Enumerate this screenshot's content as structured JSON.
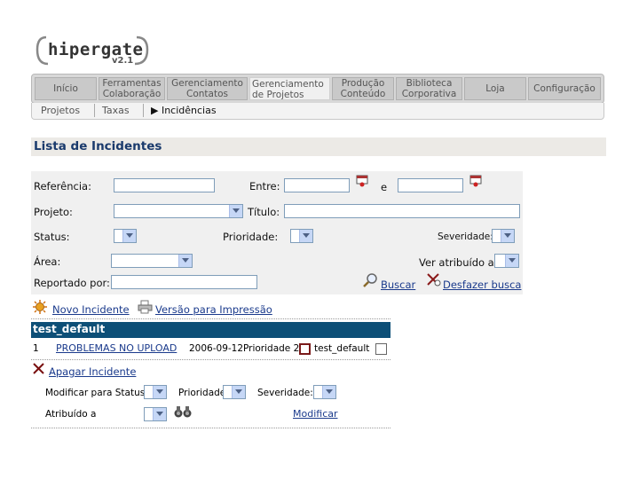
{
  "logo": {
    "name": "hipergate",
    "version": "v2.1"
  },
  "tabs": [
    {
      "l1": "Início",
      "l2": ""
    },
    {
      "l1": "Ferramentas",
      "l2": "Colaboração"
    },
    {
      "l1": "Gerenciamento",
      "l2": "Contatos"
    },
    {
      "l1": "Gerenciamento",
      "l2": "de Projetos"
    },
    {
      "l1": "Produção",
      "l2": "Conteúdo"
    },
    {
      "l1": "Biblioteca",
      "l2": "Corporativa"
    },
    {
      "l1": "Loja",
      "l2": ""
    },
    {
      "l1": "Configuração",
      "l2": ""
    }
  ],
  "subtabs": {
    "projetos": "Projetos",
    "taxas": "Taxas",
    "incidencias": "▶ Incidências"
  },
  "page_title": "Lista de Incidentes",
  "filter": {
    "referencia_label": "Referência:",
    "entre_label": "Entre:",
    "e_label": "e",
    "projeto_label": "Projeto:",
    "titulo_label": "Título:",
    "status_label": "Status:",
    "prioridade_label": "Prioridade:",
    "severidade_label": "Severidade:",
    "area_label": "Área:",
    "ver_atribuido_label": "Ver atribuído a:",
    "reportado_label": "Reportado por:",
    "buscar": "Buscar",
    "desfazer": "Desfazer busca"
  },
  "actions": {
    "novo": "Novo Incidente",
    "versao": "Versão para Impressão"
  },
  "list": {
    "group": "test_default",
    "rows": [
      {
        "num": "1",
        "title": "PROBLEMAS NO UPLOAD",
        "date": "2006-09-12",
        "priority": "Prioridade 2",
        "assignee": "test_default"
      }
    ]
  },
  "batch": {
    "apagar": "Apagar Incidente",
    "modificar_status": "Modificar para Status",
    "prioridade": "Prioridade",
    "severidade": "Severidade:",
    "atribuido": "Atribuído a",
    "modificar": "Modificar"
  },
  "colors": {
    "header_blue": "#0d4f77",
    "link": "#1a3a8c",
    "title": "#1a3a6c"
  }
}
